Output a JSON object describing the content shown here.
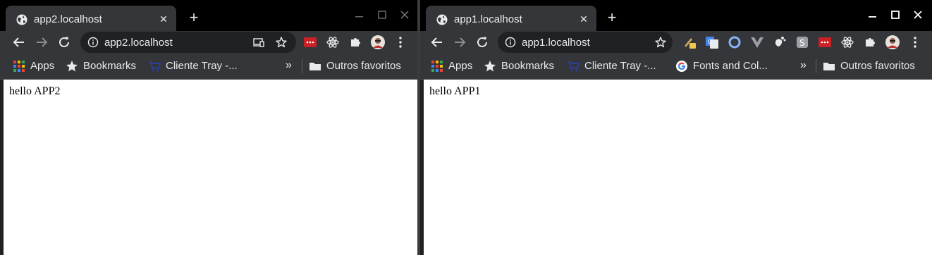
{
  "windows": [
    {
      "tab_title": "app2.localhost",
      "url": "app2.localhost",
      "page_text": "hello APP2",
      "bookmarks": [
        {
          "label": "Apps",
          "icon": "apps-grid-icon"
        },
        {
          "label": "Bookmarks",
          "icon": "star-icon"
        },
        {
          "label": "Cliente Tray -...",
          "icon": "cart-icon"
        }
      ],
      "other_bookmarks": "Outros favoritos",
      "overflow": "»"
    },
    {
      "tab_title": "app1.localhost",
      "url": "app1.localhost",
      "page_text": "hello APP1",
      "bookmarks": [
        {
          "label": "Apps",
          "icon": "apps-grid-icon"
        },
        {
          "label": "Bookmarks",
          "icon": "star-icon"
        },
        {
          "label": "Cliente Tray -...",
          "icon": "cart-icon"
        },
        {
          "label": "Fonts and Col...",
          "icon": "google-icon"
        }
      ],
      "other_bookmarks": "Outros favoritos",
      "overflow": "»"
    }
  ],
  "glyphs": {
    "close": "✕",
    "new_tab": "+"
  },
  "colors": {
    "frame": "#000000",
    "toolbar": "#35363a",
    "omnibox": "#202124",
    "text": "#e8eaed",
    "page_bg": "#ffffff"
  }
}
